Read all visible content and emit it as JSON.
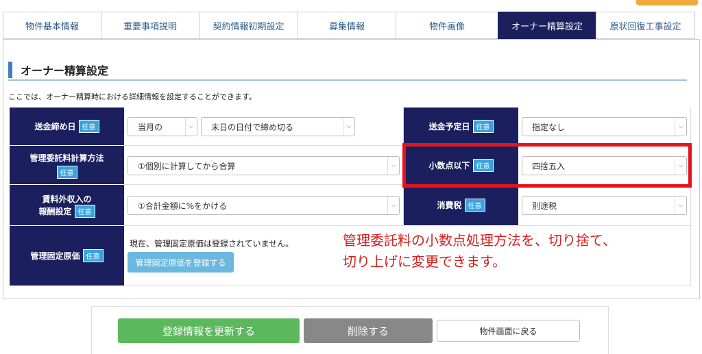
{
  "tabs": [
    {
      "label": "物件基本情報"
    },
    {
      "label": "重要事項説明"
    },
    {
      "label": "契約情報初期設定"
    },
    {
      "label": "募集情報"
    },
    {
      "label": "物件画像"
    },
    {
      "label": "オーナー精算設定"
    },
    {
      "label": "原状回復工事設定"
    }
  ],
  "section": {
    "title": "オーナー精算設定",
    "description": "ここでは、オーナー精算時における詳細情報を設定することができます。"
  },
  "badge": "任意",
  "rows": {
    "closing": {
      "label": "送金締め日",
      "select1": "当月の",
      "select2": "末日の日付で締め切る"
    },
    "scheduled": {
      "label": "送金予定日",
      "select": "指定なし"
    },
    "mgmt_fee": {
      "label": "管理委託料計算方法",
      "select": "①個別に計算してから合算"
    },
    "decimal": {
      "label": "小数点以下",
      "select": "四捨五入"
    },
    "other_income": {
      "label_line1": "賃料外収入の",
      "label_line2": "報酬設定",
      "select": "①合計金額に%をかける"
    },
    "tax": {
      "label": "消費税",
      "select": "別途税"
    },
    "fixed_cost": {
      "label": "管理固定原価",
      "text": "現在、管理固定原価は登録されていません。",
      "button": "管理固定原価を登録する"
    }
  },
  "annotation": {
    "line1": "管理委託料の小数点処理方法を、切り捨て、",
    "line2": "切り上げに変更できます。"
  },
  "buttons": {
    "update": "登録情報を更新する",
    "delete": "削除する",
    "back": "物件画面に戻る"
  },
  "colors": {
    "header_bg": "#1b1f5e",
    "badge": "#3aa3dd",
    "highlight": "#e4141d",
    "green": "#5cb85c"
  }
}
